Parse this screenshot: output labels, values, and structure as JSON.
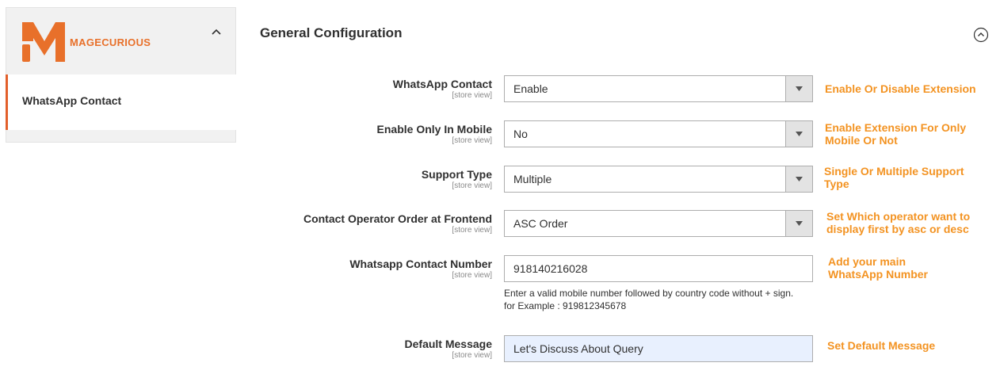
{
  "sidebar": {
    "brand": "MAGECURIOUS",
    "logo_letter": "M",
    "items": [
      {
        "label": "WhatsApp Contact",
        "active": true
      }
    ]
  },
  "section": {
    "title": "General Configuration"
  },
  "fields": [
    {
      "label": "WhatsApp Contact",
      "scope": "[store view]",
      "type": "select",
      "value": "Enable",
      "hint": "Enable Or Disable Extension"
    },
    {
      "label": "Enable Only In Mobile",
      "scope": "[store view]",
      "type": "select",
      "value": "No",
      "hint": "Enable Extension For Only Mobile Or Not"
    },
    {
      "label": "Support Type",
      "scope": "[store view]",
      "type": "select",
      "value": "Multiple",
      "hint": "Single Or Multiple Support Type"
    },
    {
      "label": "Contact Operator Order at Frontend",
      "scope": "[store view]",
      "type": "select",
      "value": "ASC Order",
      "hint": "Set Which operator want to display first by asc or desc"
    },
    {
      "label": "Whatsapp Contact Number",
      "scope": "[store view]",
      "type": "text",
      "value": "918140216028",
      "note": "Enter a valid mobile number followed by country code without + sign. for Example : 919812345678",
      "hint": "Add your main WhatsApp Number"
    },
    {
      "label": "Default Message",
      "scope": "[store view]",
      "type": "text",
      "value": "Let's Discuss About Query",
      "hint": "Set Default Message"
    }
  ],
  "colors": {
    "accent": "#e25f2a",
    "hint": "#f39322",
    "autofill": "#e8f0fe"
  },
  "icons": [
    "chevron-up-icon",
    "collapse-circle-icon",
    "dropdown-arrow-icon"
  ]
}
